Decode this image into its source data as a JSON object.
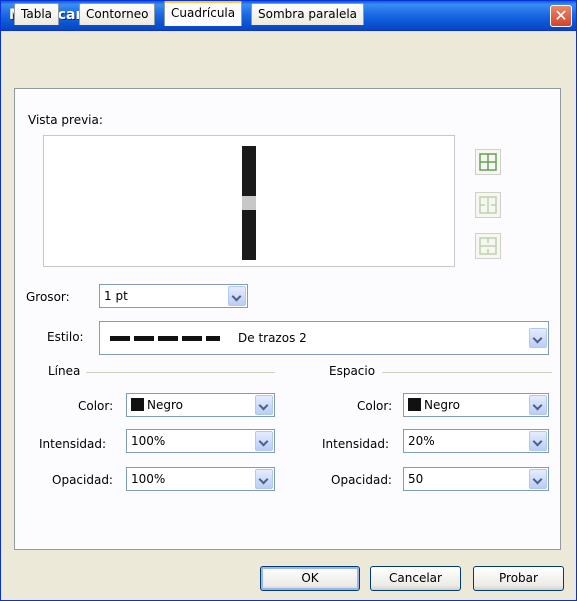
{
  "window": {
    "title": "Modificar",
    "close_label": "✕"
  },
  "tabs": [
    {
      "label": "Tabla"
    },
    {
      "label": "Contorneo"
    },
    {
      "label": "Cuadrícula"
    },
    {
      "label": "Sombra paralela"
    }
  ],
  "preview": {
    "label": "Vista previa:"
  },
  "grosor": {
    "label": "Grosor:",
    "value": "1 pt"
  },
  "estilo": {
    "label": "Estilo:",
    "value": "De trazos 2"
  },
  "linea": {
    "title": "Línea",
    "color_label": "Color:",
    "color_value": "Negro",
    "intensidad_label": "Intensidad:",
    "intensidad_value": "100%",
    "opacidad_label": "Opacidad:",
    "opacidad_value": "100%"
  },
  "espacio": {
    "title": "Espacio",
    "color_label": "Color:",
    "color_value": "Negro",
    "intensidad_label": "Intensidad:",
    "intensidad_value": "20%",
    "opacidad_label": "Opacidad:",
    "opacidad_value": "50"
  },
  "buttons": {
    "ok": "OK",
    "cancel": "Cancelar",
    "test": "Probar"
  },
  "colors": {
    "swatch_black": "#111111",
    "title_blue": "#0b55d4",
    "close_red": "#d2432a"
  }
}
